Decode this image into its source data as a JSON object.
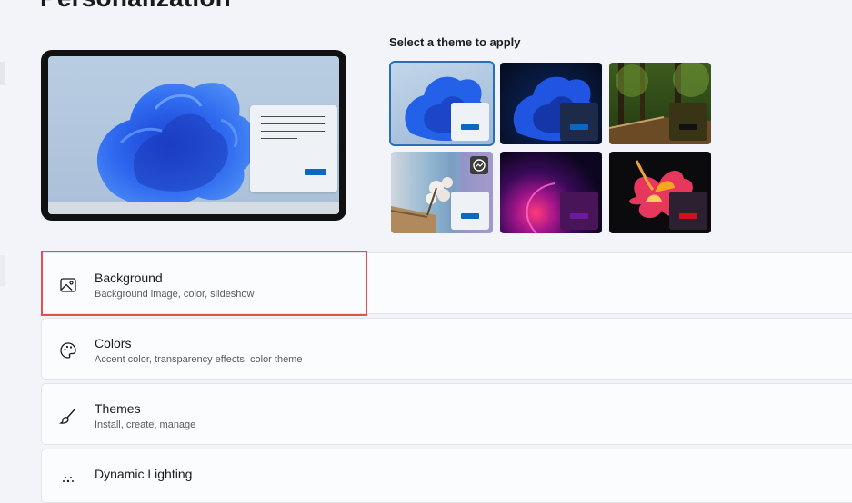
{
  "page": {
    "title": "Personalization"
  },
  "themes": {
    "heading": "Select a theme to apply",
    "items": [
      {
        "name": "theme-light",
        "selected": true
      },
      {
        "name": "theme-dark",
        "selected": false
      },
      {
        "name": "theme-forest",
        "selected": false
      },
      {
        "name": "theme-blossom",
        "selected": false
      },
      {
        "name": "theme-glow",
        "selected": false
      },
      {
        "name": "theme-flower",
        "selected": false
      }
    ]
  },
  "settings": [
    {
      "icon": "image-icon",
      "title": "Background",
      "subtitle": "Background image, color, slideshow"
    },
    {
      "icon": "palette-icon",
      "title": "Colors",
      "subtitle": "Accent color, transparency effects, color theme"
    },
    {
      "icon": "brush-icon",
      "title": "Themes",
      "subtitle": "Install, create, manage"
    },
    {
      "icon": "sparkle-icon",
      "title": "Dynamic Lighting"
    }
  ],
  "colors": {
    "accent": "#0a67c2",
    "highlight": "#e05252"
  }
}
